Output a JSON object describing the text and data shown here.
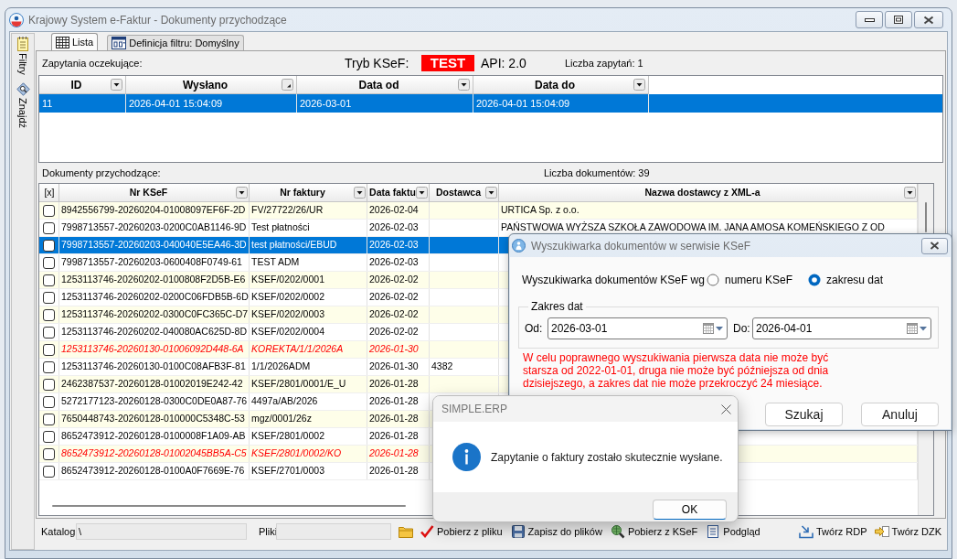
{
  "window": {
    "title": "Krajowy System e-Faktur - Dokumenty przychodzące"
  },
  "sidebar": {
    "items": [
      {
        "label": "Filtry"
      },
      {
        "label": "Znajdź"
      }
    ]
  },
  "tabs": [
    {
      "label": "Lista",
      "selected": true
    },
    {
      "label": "Definicja filtru: Domyślny",
      "selected": false
    }
  ],
  "queries": {
    "title": "Zapytania oczekujące:",
    "mode_label": "Tryb KSeF:",
    "mode": "TEST",
    "api": "API: 2.0",
    "count": "Liczba zapytań: 1",
    "columns": [
      {
        "label": "ID",
        "sorted": false
      },
      {
        "label": "Wysłano",
        "sorted": true
      },
      {
        "label": "Data od",
        "sorted": false
      },
      {
        "label": "Data do",
        "sorted": false
      }
    ],
    "rows": [
      {
        "selected": true,
        "cells": [
          "11",
          "2026-04-01 15:04:09",
          "2026-03-01",
          "2026-04-01 15:04:09"
        ]
      }
    ]
  },
  "documents": {
    "title": "Dokumenty przychodzące:",
    "count": "Liczba dokumentów: 39",
    "columns": [
      {
        "label": "[x]",
        "filter": false
      },
      {
        "label": "Nr KSeF",
        "filter": true
      },
      {
        "label": "Nr faktury",
        "filter": true
      },
      {
        "label": "Data faktu",
        "filter": true
      },
      {
        "label": "Dostawca",
        "filter": true
      },
      {
        "label": "Nazwa dostawcy z XML-a",
        "filter": true
      }
    ],
    "rows": [
      {
        "checked": false,
        "selected": false,
        "correction": false,
        "nr_ksef": "8942556799-20260204-01008097EF6F-2D",
        "nr_faktury": "FV/27722/26/UR",
        "data": "2026-02-04",
        "nazwa_xml": "URTICA Sp. z o.o."
      },
      {
        "checked": false,
        "selected": false,
        "correction": false,
        "nr_ksef": "7998713557-20260203-0200C0AB1146-9D",
        "nr_faktury": "Test płatności",
        "data": "2026-02-03",
        "nazwa_xml": "PAŃSTWOWA WYŻSZA SZKOŁA ZAWODOWA IM. JANA AMOSA KOMEŃSKIEGO Z OD"
      },
      {
        "checked": false,
        "selected": true,
        "correction": false,
        "nr_ksef": "7998713557-20260203-040040E5EA46-3D",
        "nr_faktury": "test płatności/EBUD",
        "data": "2026-02-03"
      },
      {
        "checked": false,
        "selected": false,
        "correction": false,
        "nr_ksef": "7998713557-20260203-0600408F0749-61",
        "nr_faktury": "TEST ADM",
        "data": "2026-02-03"
      },
      {
        "checked": false,
        "selected": false,
        "correction": false,
        "nr_ksef": "1253113746-20260202-0100808F2D5B-E6",
        "nr_faktury": "KSEF/0202/0001",
        "data": "2026-02-02"
      },
      {
        "checked": false,
        "selected": false,
        "correction": false,
        "nr_ksef": "1253113746-20260202-0200C06FDB5B-6D",
        "nr_faktury": "KSEF/0202/0002",
        "data": "2026-02-02"
      },
      {
        "checked": false,
        "selected": false,
        "correction": false,
        "nr_ksef": "1253113746-20260202-0300C0FC365C-D7",
        "nr_faktury": "KSEF/0202/0003",
        "data": "2026-02-02"
      },
      {
        "checked": false,
        "selected": false,
        "correction": false,
        "nr_ksef": "1253113746-20260202-040080AC625D-8D",
        "nr_faktury": "KSEF/0202/0004",
        "data": "2026-02-02"
      },
      {
        "checked": false,
        "selected": false,
        "correction": true,
        "nr_ksef": "1253113746-20260130-01006092D448-6A",
        "nr_faktury": "KOREKTA/1/1/2026A",
        "data": "2026-01-30"
      },
      {
        "checked": false,
        "selected": false,
        "correction": false,
        "nr_ksef": "1253113746-20260130-0100C08AFB3F-81",
        "nr_faktury": "1/1/2026ADM",
        "data": "2026-01-30",
        "dostawca": "4382"
      },
      {
        "checked": false,
        "selected": false,
        "correction": false,
        "nr_ksef": "2462387537-20260128-01002019E242-42",
        "nr_faktury": "KSEF/2801/0001/E_U",
        "data": "2026-01-28"
      },
      {
        "checked": false,
        "selected": false,
        "correction": false,
        "nr_ksef": "5272177123-20260128-0300C0DE0A87-76",
        "nr_faktury": "4497a/AB/2026",
        "data": "2026-01-28"
      },
      {
        "checked": false,
        "selected": false,
        "correction": false,
        "nr_ksef": "7650448743-20260128-010000C5348C-53",
        "nr_faktury": "mgz/0001/26z",
        "data": "2026-01-28"
      },
      {
        "checked": false,
        "selected": false,
        "correction": false,
        "nr_ksef": "8652473912-20260128-0100008F1A09-AB",
        "nr_faktury": "KSEF/2801/0002",
        "data": "2026-01-28"
      },
      {
        "checked": false,
        "selected": false,
        "correction": true,
        "nr_ksef": "8652473912-20260128-01002045BB5A-C5",
        "nr_faktury": "KSEF/2801/0002/KO",
        "data": "2026-01-28"
      },
      {
        "checked": false,
        "selected": false,
        "correction": false,
        "nr_ksef": "8652473912-20260128-0100A0F7669E-76",
        "nr_faktury": "KSEF/2701/0003",
        "data": "2026-01-28"
      }
    ]
  },
  "search_dialog": {
    "title": "Wyszukiwarka dokumentów w serwisie KSeF",
    "search_by": {
      "label": "Wyszukiwarka dokumentów KSeF wg",
      "options": [
        {
          "label": "numeru KSeF",
          "selected": false
        },
        {
          "label": "zakresu dat",
          "selected": true
        }
      ]
    },
    "date_range": {
      "legend": "Zakres dat",
      "from": {
        "label": "Od:",
        "value": "2026-03-01"
      },
      "to": {
        "label": "Do:",
        "value": "2026-04-01"
      }
    },
    "warning": "W celu poprawnego wyszukiwania pierwsza data nie może być starsza od 2022-01-01, druga nie może być późniejsza od dnia dzisiejszego, a zakres dat nie może przekroczyć 24 miesiące.",
    "buttons": [
      "Szukaj",
      "Anuluj"
    ]
  },
  "message_box": {
    "title": "SIMPLE.ERP",
    "message": "Zapytanie o faktury zostało skutecznie wysłane.",
    "buttons": [
      "OK"
    ]
  },
  "bottom_bar": {
    "catalog": {
      "label": "Katalog",
      "value": "\\"
    },
    "files": {
      "label": "Pliki"
    },
    "actions": [
      {
        "label": "Pobierz z pliku"
      },
      {
        "label": "Zapisz do plików"
      },
      {
        "label": "Pobierz z KSeF"
      },
      {
        "label": "Podgląd"
      }
    ],
    "right_actions": [
      {
        "label": "Twórz RDP"
      },
      {
        "label": "Twórz DZK"
      }
    ]
  }
}
